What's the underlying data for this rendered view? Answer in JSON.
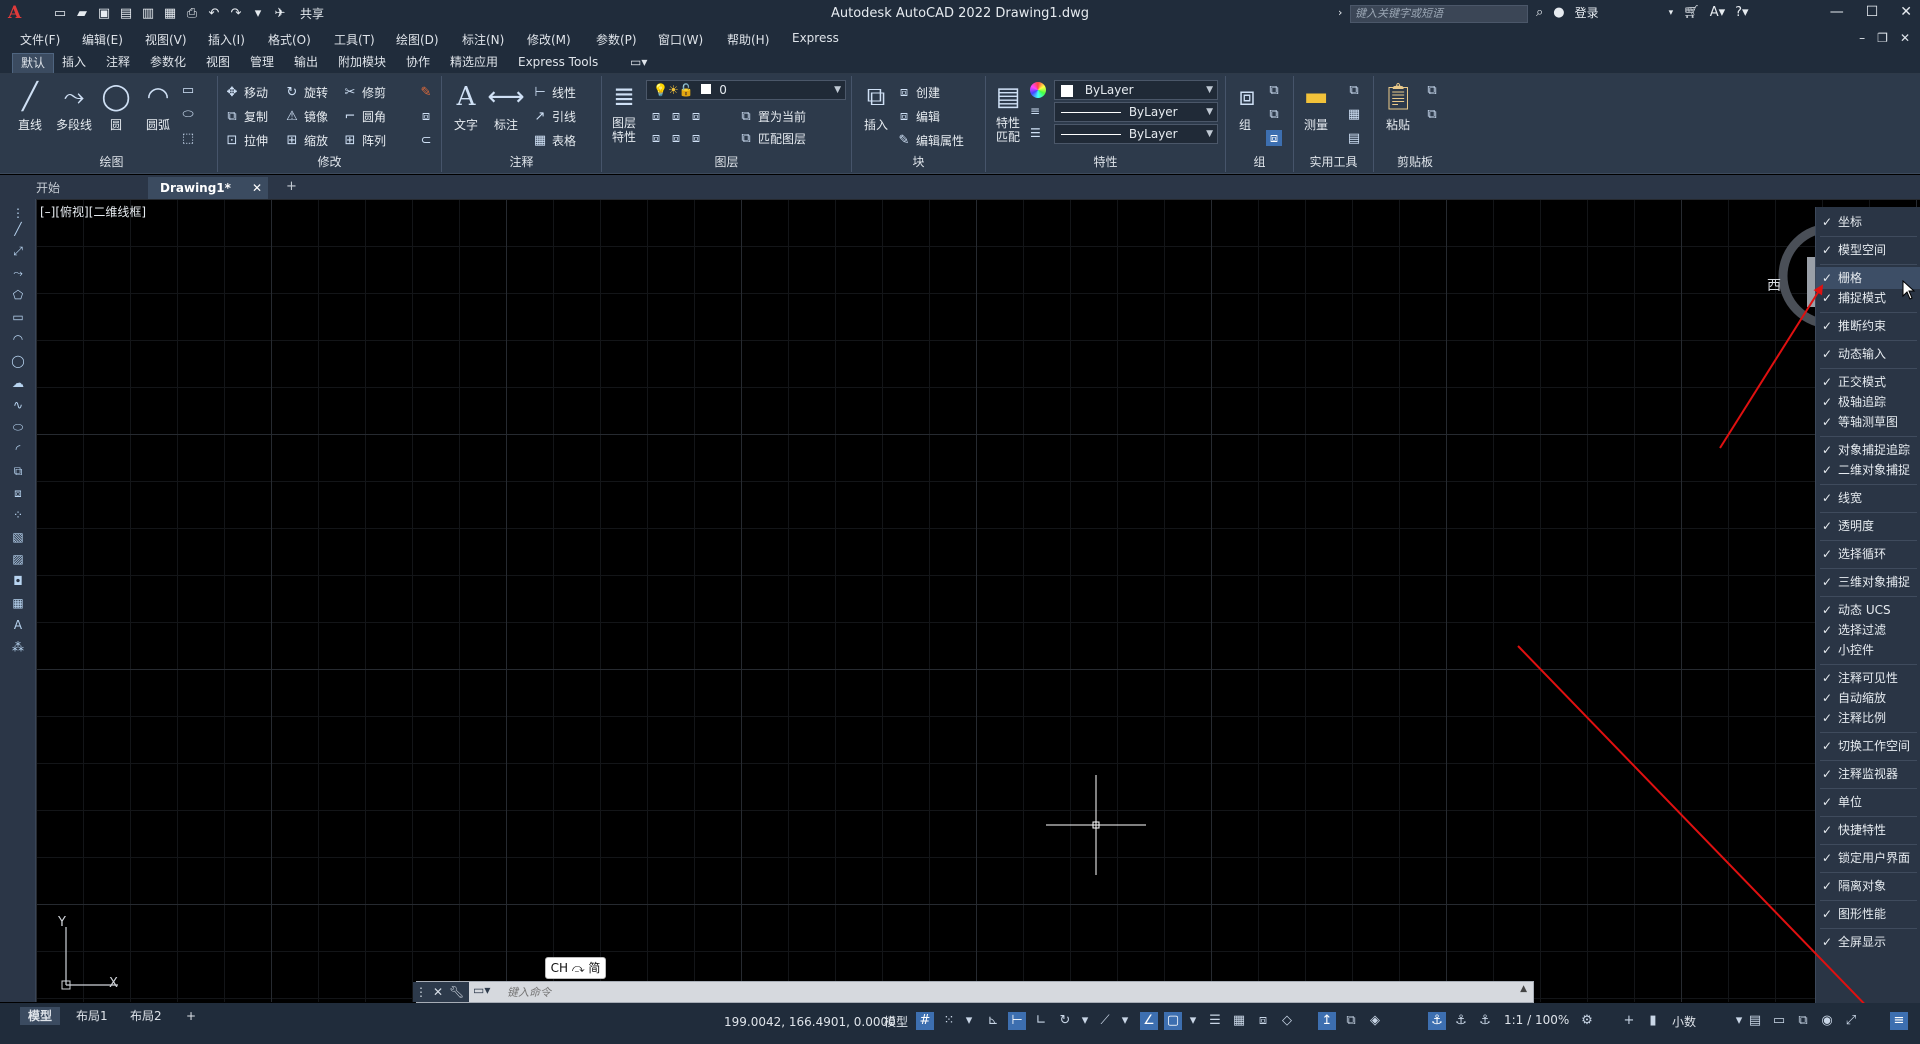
{
  "app": {
    "title": "Autodesk AutoCAD 2022    Drawing1.dwg",
    "logo": "A",
    "share": "共享",
    "search_placeholder": "键入关键字或短语",
    "login": "登录"
  },
  "menu": [
    "文件(F)",
    "编辑(E)",
    "视图(V)",
    "插入(I)",
    "格式(O)",
    "工具(T)",
    "绘图(D)",
    "标注(N)",
    "修改(M)",
    "参数(P)",
    "窗口(W)",
    "帮助(H)",
    "Express"
  ],
  "ribbon_tabs": [
    "默认",
    "插入",
    "注释",
    "参数化",
    "视图",
    "管理",
    "输出",
    "附加模块",
    "协作",
    "精选应用",
    "Express Tools"
  ],
  "ribbon": {
    "draw": {
      "title": "绘图",
      "line": "直线",
      "polyline": "多段线",
      "circle": "圆",
      "arc": "圆弧"
    },
    "modify": {
      "title": "修改",
      "move": "移动",
      "rotate": "旋转",
      "trim": "修剪",
      "copy": "复制",
      "mirror": "镜像",
      "fillet": "圆角",
      "stretch": "拉伸",
      "scale": "缩放",
      "array": "阵列"
    },
    "annotation": {
      "title": "注释",
      "text": "文字",
      "dimension": "标注",
      "linear": "线性",
      "leader": "引线",
      "table": "表格"
    },
    "layers": {
      "title": "图层",
      "layer_props": "图层\n特性",
      "layer_current": "0",
      "set_current": "置为当前",
      "match_layer": "匹配图层"
    },
    "block": {
      "title": "块",
      "insert": "插入",
      "create": "创建",
      "edit": "编辑",
      "edit_attr": "编辑属性"
    },
    "properties": {
      "title": "特性",
      "match": "特性\n匹配",
      "color": "ByLayer",
      "linetype": "ByLayer",
      "lineweight": "ByLayer"
    },
    "groups": {
      "title": "组",
      "group": "组"
    },
    "utilities": {
      "title": "实用工具",
      "measure": "测量"
    },
    "clipboard": {
      "title": "剪贴板",
      "paste": "粘贴"
    }
  },
  "file_tabs": {
    "start": "开始",
    "drawing": "Drawing1*"
  },
  "viewport_label": "[–][俯视][二维线框]",
  "compass_label": "西",
  "ucs": {
    "x": "X",
    "y": "Y"
  },
  "popup_menu": [
    {
      "label": "坐标",
      "group_end": true
    },
    {
      "label": "模型空间",
      "group_end": true
    },
    {
      "label": "栅格",
      "highlight": true
    },
    {
      "label": "捕捉模式",
      "group_end": true
    },
    {
      "label": "推断约束",
      "group_end": true
    },
    {
      "label": "动态输入",
      "group_end": true
    },
    {
      "label": "正交模式"
    },
    {
      "label": "极轴追踪"
    },
    {
      "label": "等轴测草图",
      "group_end": true
    },
    {
      "label": "对象捕捉追踪"
    },
    {
      "label": "二维对象捕捉",
      "group_end": true
    },
    {
      "label": "线宽",
      "group_end": true
    },
    {
      "label": "透明度",
      "group_end": true
    },
    {
      "label": "选择循环",
      "group_end": true
    },
    {
      "label": "三维对象捕捉",
      "group_end": true
    },
    {
      "label": "动态 UCS"
    },
    {
      "label": "选择过滤"
    },
    {
      "label": "小控件",
      "group_end": true
    },
    {
      "label": "注释可见性"
    },
    {
      "label": "自动缩放"
    },
    {
      "label": "注释比例",
      "group_end": true
    },
    {
      "label": "切换工作空间",
      "group_end": true
    },
    {
      "label": "注释监视器",
      "group_end": true
    },
    {
      "label": "单位",
      "group_end": true
    },
    {
      "label": "快捷特性",
      "group_end": true
    },
    {
      "label": "锁定用户界面",
      "group_end": true
    },
    {
      "label": "隔离对象",
      "group_end": true
    },
    {
      "label": "图形性能",
      "group_end": true
    },
    {
      "label": "全屏显示"
    }
  ],
  "command": {
    "placeholder": "键入命令"
  },
  "ime": "CH ⤼ 简",
  "status": {
    "layout_tabs": [
      "模型",
      "布局1",
      "布局2"
    ],
    "coords": "199.0042, 166.4901, 0.0000",
    "model": "模型",
    "scale": "1:1 / 100%",
    "units": "小数"
  },
  "colors": {
    "accent": "#3d6fb0",
    "background": "#000000",
    "chrome": "#202c3b",
    "ribbon": "#2d3a4b",
    "annotation_arrow": "#e01010"
  }
}
